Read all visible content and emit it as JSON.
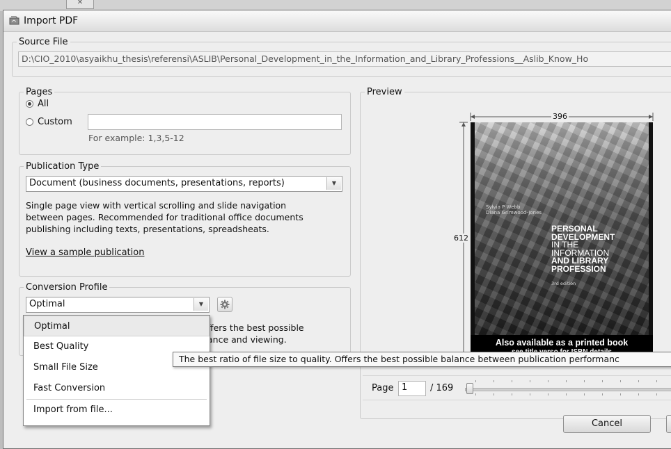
{
  "window": {
    "title": "Import PDF"
  },
  "source_file": {
    "legend": "Source File",
    "path": "D:\\CIO_2010\\asyaikhu_thesis\\referensi\\ASLIB\\Personal_Development_in_the_Information_and_Library_Professions__Aslib_Know_Ho"
  },
  "pages": {
    "legend": "Pages",
    "all_label": "All",
    "custom_label": "Custom",
    "custom_value": "",
    "hint": "For example: 1,3,5-12",
    "selected": "All"
  },
  "publication_type": {
    "legend": "Publication Type",
    "selected": "Document (business documents, presentations, reports)",
    "description": "Single page view with vertical scrolling and slide navigation between pages. Recommended for traditional office documents publishing including texts, presentations, spreadsheats.",
    "description_lines": [
      "Single page view with vertical scrolling and slide navigation",
      "between pages. Recommended for traditional office documents",
      "publishing including texts, presentations, spreadsheats."
    ],
    "sample_link": "View a sample publication"
  },
  "conversion_profile": {
    "legend": "Conversion Profile",
    "selected": "Optimal",
    "desc_fragment_1": "ffers the best possible",
    "desc_fragment_2": "ance and viewing.",
    "options": [
      "Optimal",
      "Best Quality",
      "Small File Size",
      "Fast Conversion"
    ],
    "import_option": "Import from file..."
  },
  "tooltip": "The best ratio of file size to quality. Offers the best possible balance between publication performanc",
  "preview": {
    "legend": "Preview",
    "width_label": "396",
    "height_label": "612",
    "cover": {
      "authors": [
        "Sylvia P Webb",
        "Diana Grimwood-Jones"
      ],
      "title_lines": [
        "PERSONAL",
        "DEVELOPMENT",
        "IN THE",
        "INFORMATION",
        "AND LIBRARY",
        "PROFESSION"
      ],
      "edition": "3rd edition",
      "banner_line1": "Also available as a printed book",
      "banner_line2": "see title verso for ISBN details"
    },
    "page_label": "Page",
    "page_value": "1",
    "page_total": "/ 169",
    "page_fraction": 0.0
  },
  "buttons": {
    "cancel": "Cancel"
  },
  "colors": {
    "window_bg": "#eeeeee",
    "accent": "#000000"
  }
}
